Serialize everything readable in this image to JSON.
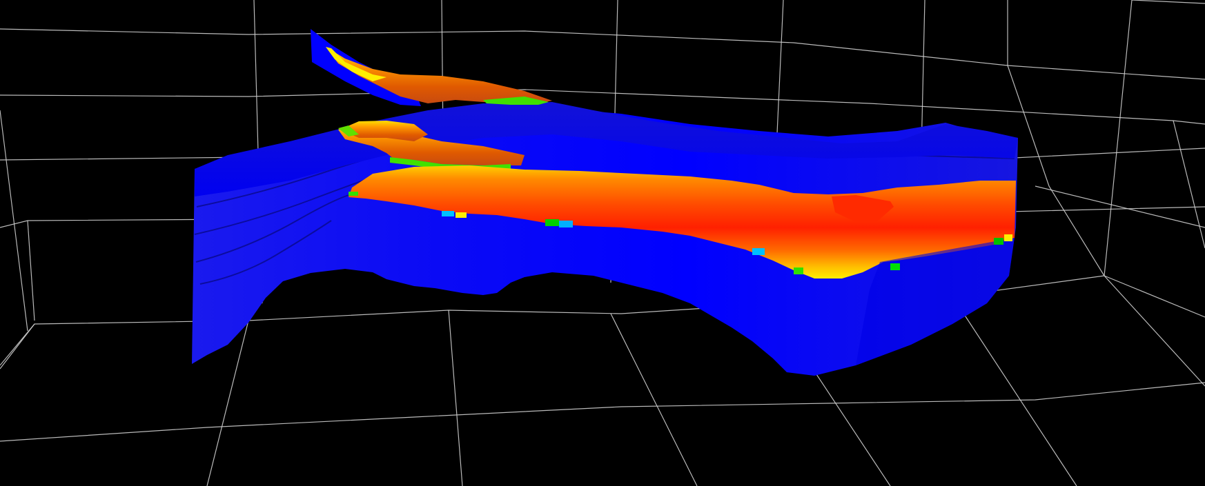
{
  "scene": {
    "background_color": "#000000",
    "grid_color": "#cfcfcf",
    "colormap": [
      "#0000ff",
      "#00b0ff",
      "#00e000",
      "#ffff00",
      "#ff9900",
      "#ff4400",
      "#ff1a00"
    ],
    "object": "3d-reservoir-model-with-property-coloring"
  }
}
